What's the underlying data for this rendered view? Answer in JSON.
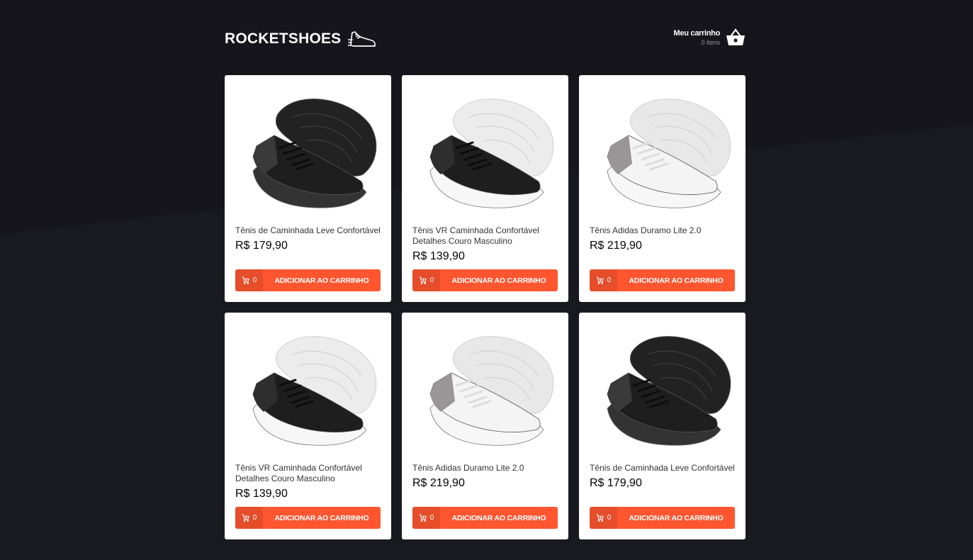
{
  "header": {
    "logo_text": "ROCKETSHOES",
    "cart_title": "Meu carrinho",
    "cart_count": "0 itens"
  },
  "colors": {
    "background": "#191920",
    "accent": "#ff5630"
  },
  "products": [
    {
      "title": "Tênis de Caminhada Leve Confortável",
      "price": "R$ 179,90",
      "amount": "0",
      "button": "ADICIONAR AO CARRINHO",
      "variant": "black"
    },
    {
      "title": "Tênis VR Caminhada Confortável Detalhes Couro Masculino",
      "price": "R$ 139,90",
      "amount": "0",
      "button": "ADICIONAR AO CARRINHO",
      "variant": "black-white"
    },
    {
      "title": "Tênis Adidas Duramo Lite 2.0",
      "price": "R$ 219,90",
      "amount": "0",
      "button": "ADICIONAR AO CARRINHO",
      "variant": "white-grey"
    },
    {
      "title": "Tênis VR Caminhada Confortável Detalhes Couro Masculino",
      "price": "R$ 139,90",
      "amount": "0",
      "button": "ADICIONAR AO CARRINHO",
      "variant": "black-white"
    },
    {
      "title": "Tênis Adidas Duramo Lite 2.0",
      "price": "R$ 219,90",
      "amount": "0",
      "button": "ADICIONAR AO CARRINHO",
      "variant": "white-grey"
    },
    {
      "title": "Tênis de Caminhada Leve Confortável",
      "price": "R$ 179,90",
      "amount": "0",
      "button": "ADICIONAR AO CARRINHO",
      "variant": "black"
    }
  ]
}
